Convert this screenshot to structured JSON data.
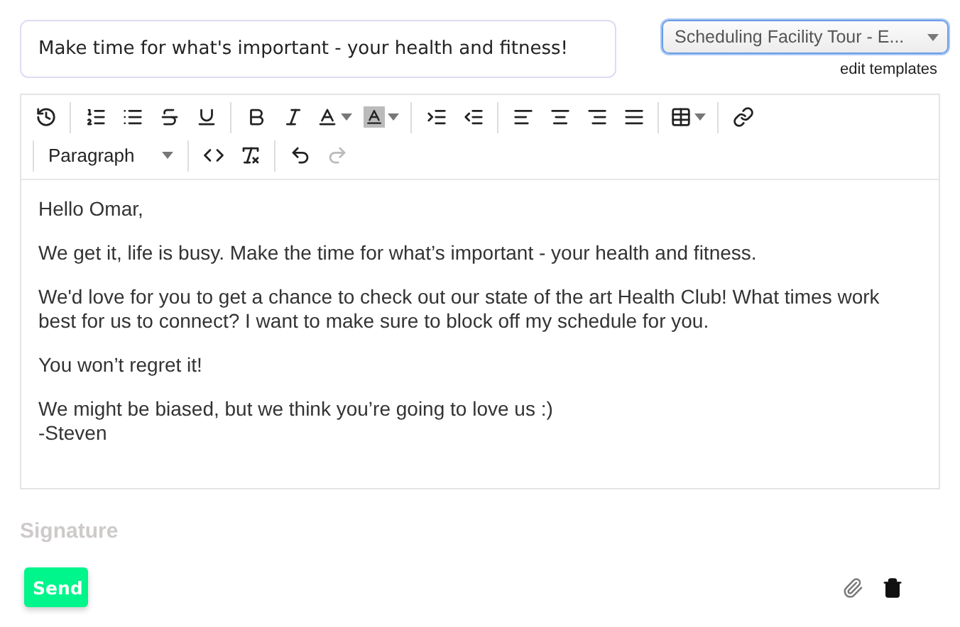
{
  "subject": {
    "value": "Make time for what's important - your health and fitness!"
  },
  "template_select": {
    "value": "Scheduling Facility Tour - E...",
    "focused": true
  },
  "edit_templates_link": "edit templates",
  "toolbar": {
    "block_format": "Paragraph",
    "undo_disabled": false,
    "redo_disabled": true
  },
  "body": {
    "paragraphs": [
      [
        "Hello Omar,"
      ],
      [
        "We get it, life is busy. Make the time for what’s important - your health and fitness."
      ],
      [
        "We'd love for you to get a chance to check out our state of the art Health Club! What times work best for us to connect? I want to make sure to block off my schedule for you."
      ],
      [
        "You won’t regret it!"
      ],
      [
        "We might be biased, but we think you’re going to love us :)",
        "-Steven"
      ]
    ]
  },
  "signature_label": "Signature",
  "send_button": "Send"
}
